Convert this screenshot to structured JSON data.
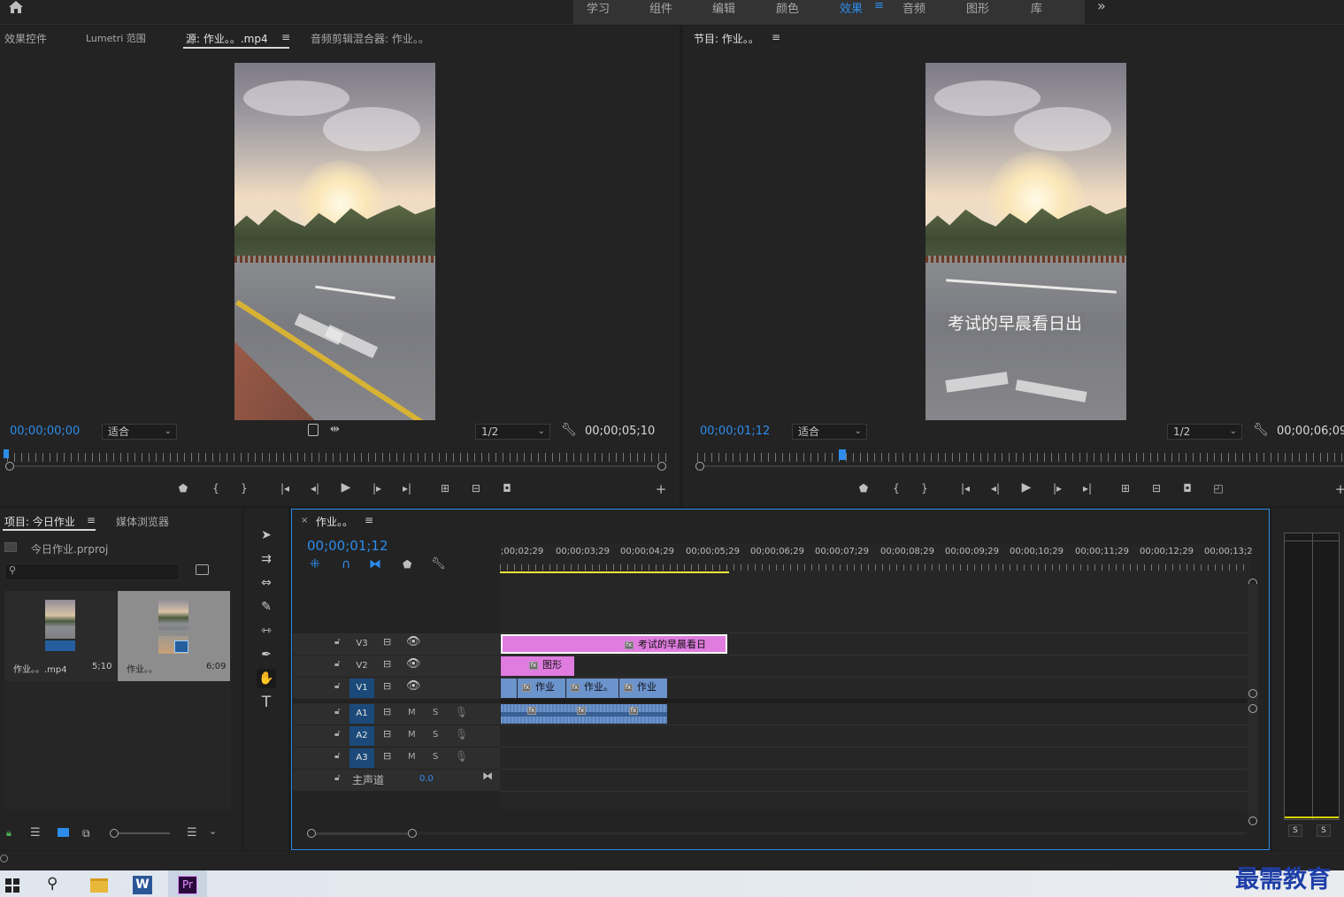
{
  "workspaces": [
    "学习",
    "组件",
    "编辑",
    "颜色",
    "效果",
    "音频",
    "图形",
    "库"
  ],
  "workspace_overflow": "»",
  "source_panel": {
    "tabs": [
      "效果控件",
      "Lumetri 范围",
      "源: 作业。。.mp4",
      "音频剪辑混合器: 作业。。"
    ],
    "timecode": "00;00;00;00",
    "fit": "适合",
    "resolution": "1/2",
    "duration": "00;00;05;10"
  },
  "program_panel": {
    "tab": "节目: 作业。。",
    "timecode": "00;00;01;12",
    "fit": "适合",
    "resolution": "1/2",
    "duration": "00;00;06;09",
    "subtitle": "考试的早晨看日出"
  },
  "project_panel": {
    "tabs": [
      "项目: 今日作业",
      "媒体浏览器"
    ],
    "project_file": "今日作业.prproj",
    "items": [
      {
        "name": "作业。。.mp4",
        "duration": "5;10"
      },
      {
        "name": "作业。。",
        "duration": "6;09"
      }
    ]
  },
  "timeline": {
    "tab": "作业。。",
    "close": "×",
    "timecode": "00;00;01;12",
    "ruler_labels": [
      ";00;02;29",
      "00;00;03;29",
      "00;00;04;29",
      "00;00;05;29",
      "00;00;06;29",
      "00;00;07;29",
      "00;00;08;29",
      "00;00;09;29",
      "00;00;10;29",
      "00;00;11;29",
      "00;00;12;29",
      "00;00;13;2"
    ],
    "video_tracks": [
      "V3",
      "V2",
      "V1"
    ],
    "audio_tracks": [
      "A1",
      "A2",
      "A3"
    ],
    "track_toggle_m": "M",
    "track_toggle_s": "S",
    "master": {
      "label": "主声道",
      "value": "0.0"
    },
    "clips": {
      "v3": "考试的早晨看日",
      "v2": "图形",
      "v1": [
        "作业",
        "作业。",
        "作业"
      ]
    }
  },
  "audio_meter": {
    "solo_labels": [
      "S",
      "S"
    ]
  },
  "watermark": "最需教育",
  "colors": {
    "accent_blue": "#2d8ceb",
    "clip_pink": "#e07ce0",
    "clip_blue": "#6b93cc",
    "playhead_yellow": "#f0e33a"
  }
}
